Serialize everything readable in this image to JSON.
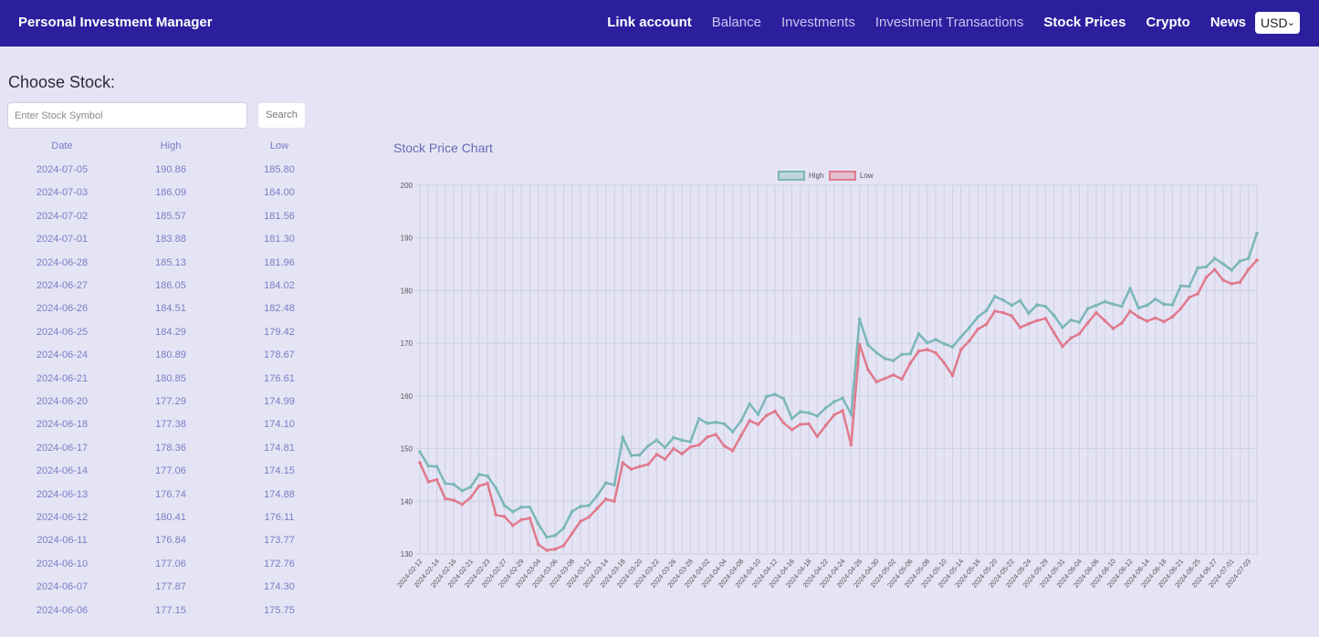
{
  "nav": {
    "brand": "Personal Investment Manager",
    "links": [
      {
        "label": "Link account",
        "style": "bright"
      },
      {
        "label": "Balance",
        "style": "dim"
      },
      {
        "label": "Investments",
        "style": "dim"
      },
      {
        "label": "Investment Transactions",
        "style": "dim"
      },
      {
        "label": "Stock Prices",
        "style": "bright"
      },
      {
        "label": "Crypto",
        "style": "bright"
      },
      {
        "label": "News",
        "style": "bright"
      }
    ],
    "currency": "USD"
  },
  "stock_panel": {
    "title": "Choose Stock:",
    "search_placeholder": "Enter Stock Symbol",
    "search_button": "Search",
    "headers": [
      "Date",
      "High",
      "Low"
    ],
    "rows": [
      [
        "2024-07-05",
        "190.86",
        "185.80"
      ],
      [
        "2024-07-03",
        "186.09",
        "184.00"
      ],
      [
        "2024-07-02",
        "185.57",
        "181.56"
      ],
      [
        "2024-07-01",
        "183.88",
        "181.30"
      ],
      [
        "2024-06-28",
        "185.13",
        "181.96"
      ],
      [
        "2024-06-27",
        "186.05",
        "184.02"
      ],
      [
        "2024-06-26",
        "184.51",
        "182.48"
      ],
      [
        "2024-06-25",
        "184.29",
        "179.42"
      ],
      [
        "2024-06-24",
        "180.89",
        "178.67"
      ],
      [
        "2024-06-21",
        "180.85",
        "176.61"
      ],
      [
        "2024-06-20",
        "177.29",
        "174.99"
      ],
      [
        "2024-06-18",
        "177.38",
        "174.10"
      ],
      [
        "2024-06-17",
        "178.36",
        "174.81"
      ],
      [
        "2024-06-14",
        "177.06",
        "174.15"
      ],
      [
        "2024-06-13",
        "176.74",
        "174.88"
      ],
      [
        "2024-06-12",
        "180.41",
        "176.11"
      ],
      [
        "2024-06-11",
        "176.84",
        "173.77"
      ],
      [
        "2024-06-10",
        "177.06",
        "172.76"
      ],
      [
        "2024-06-07",
        "177.87",
        "174.30"
      ],
      [
        "2024-06-06",
        "177.15",
        "175.75"
      ]
    ]
  },
  "chart_title": "Stock Price Chart",
  "chart_data": {
    "type": "line",
    "legend_placement": "top-center",
    "grid": true,
    "ylim": [
      130,
      200
    ],
    "yticks": [
      130,
      140,
      150,
      160,
      170,
      180,
      190,
      200
    ],
    "tick_labels": [
      "2024-02-12",
      "2024-02-14",
      "2024-02-16",
      "2024-02-21",
      "2024-02-23",
      "2024-02-27",
      "2024-02-29",
      "2024-03-04",
      "2024-03-06",
      "2024-03-08",
      "2024-03-12",
      "2024-03-14",
      "2024-03-18",
      "2024-03-20",
      "2024-03-22",
      "2024-03-26",
      "2024-03-28",
      "2024-04-02",
      "2024-04-04",
      "2024-04-08",
      "2024-04-10",
      "2024-04-12",
      "2024-04-16",
      "2024-04-18",
      "2024-04-22",
      "2024-04-24",
      "2024-04-26",
      "2024-04-30",
      "2024-05-02",
      "2024-05-06",
      "2024-05-08",
      "2024-05-10",
      "2024-05-14",
      "2024-05-16",
      "2024-05-20",
      "2024-05-22",
      "2024-05-24",
      "2024-05-29",
      "2024-05-31",
      "2024-06-04",
      "2024-06-06",
      "2024-06-10",
      "2024-06-12",
      "2024-06-14",
      "2024-06-18",
      "2024-06-21",
      "2024-06-25",
      "2024-06-27",
      "2024-07-01",
      "2024-07-03"
    ],
    "series": [
      {
        "name": "High",
        "color": "#7bb7b7",
        "values": [
          149.4,
          146.7,
          146.6,
          143.4,
          143.2,
          142.0,
          142.7,
          145.1,
          144.8,
          142.5,
          139.2,
          138.0,
          138.9,
          138.9,
          135.7,
          133.2,
          133.5,
          134.9,
          138.1,
          139.0,
          139.2,
          141.1,
          143.5,
          143.1,
          152.1,
          148.7,
          148.8,
          150.5,
          151.6,
          150.2,
          152.1,
          151.6,
          151.3,
          155.7,
          154.8,
          155.0,
          154.7,
          153.2,
          155.3,
          158.5,
          156.5,
          159.9,
          160.3,
          159.5,
          155.7,
          157.0,
          156.8,
          156.2,
          157.7,
          158.9,
          159.6,
          156.5,
          174.6,
          169.7,
          168.2,
          167.1,
          166.7,
          167.9,
          168.0,
          171.8,
          170.1,
          170.7,
          169.9,
          169.3,
          171.2,
          173.0,
          175.0,
          176.2,
          178.9,
          178.2,
          177.2,
          178.1,
          175.7,
          177.3,
          177.0,
          175.3,
          173.0,
          174.4,
          174.0,
          176.6,
          177.2,
          177.9,
          177.4,
          177.0,
          180.4,
          176.7,
          177.2,
          178.4,
          177.4,
          177.3,
          180.9,
          180.8,
          184.3,
          184.5,
          186.1,
          185.1,
          183.9,
          185.6,
          186.1,
          190.9
        ]
      },
      {
        "name": "Low",
        "color": "#e07a8c",
        "values": [
          147.3,
          143.7,
          144.1,
          140.5,
          140.2,
          139.4,
          140.7,
          142.9,
          143.4,
          137.4,
          137.1,
          135.4,
          136.5,
          136.8,
          131.8,
          130.7,
          130.9,
          131.6,
          133.9,
          136.2,
          137.0,
          138.7,
          140.4,
          140.0,
          147.3,
          146.1,
          146.6,
          147.0,
          148.9,
          148.0,
          150.0,
          149.0,
          150.3,
          150.7,
          152.2,
          152.7,
          150.5,
          149.6,
          152.5,
          155.3,
          154.6,
          156.3,
          157.1,
          154.9,
          153.6,
          154.6,
          154.7,
          152.3,
          154.4,
          156.4,
          157.2,
          150.7,
          169.8,
          165.0,
          162.7,
          163.3,
          164.0,
          163.2,
          166.2,
          168.5,
          168.8,
          168.2,
          166.3,
          163.9,
          168.8,
          170.5,
          172.7,
          173.6,
          176.1,
          175.8,
          175.2,
          173.0,
          173.7,
          174.3,
          174.7,
          172.0,
          169.4,
          171.0,
          171.8,
          173.9,
          175.8,
          174.3,
          172.8,
          173.8,
          176.1,
          175.0,
          174.2,
          174.8,
          174.1,
          175.0,
          176.6,
          178.7,
          179.4,
          182.5,
          184.0,
          182.0,
          181.3,
          181.6,
          184.0,
          185.8
        ]
      }
    ]
  }
}
